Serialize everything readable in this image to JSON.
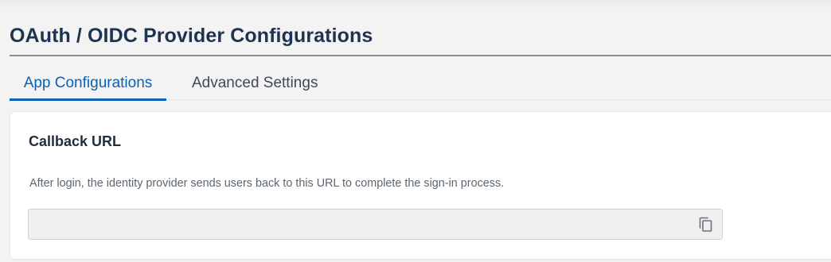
{
  "page": {
    "title": "OAuth / OIDC Provider Configurations"
  },
  "tabs": [
    {
      "label": "App Configurations",
      "active": true
    },
    {
      "label": "Advanced Settings",
      "active": false
    }
  ],
  "callback": {
    "heading": "Callback URL",
    "description": "After login, the identity provider sends users back to this URL to complete the sign-in process.",
    "url_value": "",
    "copy_icon": "copy-icon"
  },
  "colors": {
    "title": "#1f3350",
    "accent": "#0a61b5",
    "background": "#f3f3f3",
    "card": "#ffffff",
    "field_background": "#efefef"
  }
}
